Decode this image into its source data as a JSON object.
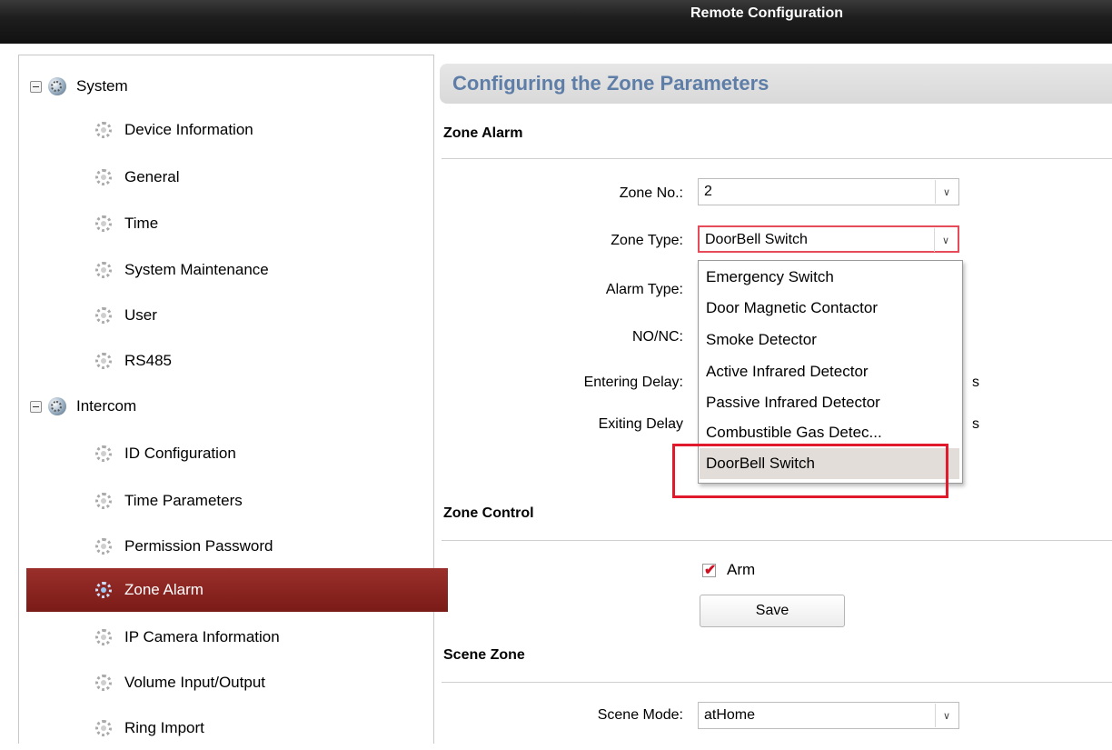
{
  "window": {
    "title": "Remote Configuration"
  },
  "sidebar": {
    "groups": [
      {
        "label": "System"
      },
      {
        "label": "Intercom"
      }
    ],
    "system_items": [
      {
        "label": "Device Information"
      },
      {
        "label": "General"
      },
      {
        "label": "Time"
      },
      {
        "label": "System Maintenance"
      },
      {
        "label": "User"
      },
      {
        "label": "RS485"
      }
    ],
    "intercom_items": [
      {
        "label": "ID Configuration"
      },
      {
        "label": "Time Parameters"
      },
      {
        "label": "Permission Password"
      },
      {
        "label": "Zone Alarm"
      },
      {
        "label": "IP Camera Information"
      },
      {
        "label": "Volume Input/Output"
      },
      {
        "label": "Ring Import"
      }
    ]
  },
  "main": {
    "page_title": "Configuring the Zone Parameters",
    "zone_alarm": {
      "title": "Zone Alarm",
      "zone_no": {
        "label": "Zone No.:",
        "value": "2"
      },
      "zone_type": {
        "label": "Zone Type:",
        "value": "DoorBell Switch"
      },
      "alarm_type": {
        "label": "Alarm Type:"
      },
      "no_nc": {
        "label": "NO/NC:"
      },
      "entering_delay": {
        "label": "Entering Delay:",
        "unit": "s"
      },
      "exiting_delay": {
        "label": "Exiting Delay",
        "unit": "s"
      }
    },
    "zone_type_options": [
      "Emergency Switch",
      "Door Magnetic Contactor",
      "Smoke Detector",
      "Active Infrared Detector",
      "Passive Infrared Detector",
      "Combustible Gas Detec...",
      "DoorBell Switch"
    ],
    "zone_control": {
      "title": "Zone Control",
      "arm_label": "Arm",
      "arm_checked": true,
      "save_label": "Save"
    },
    "scene_zone": {
      "title": "Scene Zone",
      "scene_mode": {
        "label": "Scene Mode:",
        "value": "atHome"
      }
    }
  },
  "colors": {
    "selected_item": "#8b2520",
    "page_title": "#5e7ea8",
    "annotation_red": "#e0192c"
  }
}
